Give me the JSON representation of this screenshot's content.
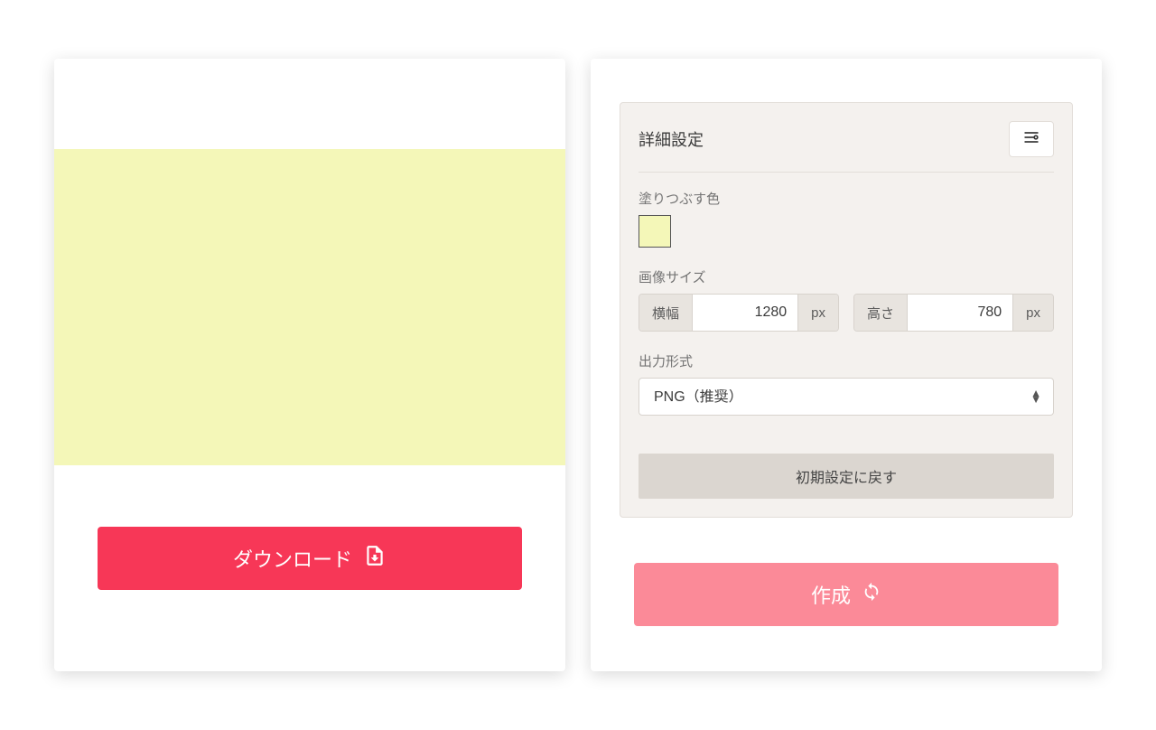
{
  "preview": {
    "fill_color": "#F4F7B8"
  },
  "settings": {
    "title": "詳細設定",
    "fill_color": {
      "label": "塗りつぶす色",
      "value": "#F4F7B8"
    },
    "image_size": {
      "label": "画像サイズ",
      "width_label": "横幅",
      "width_value": "1280",
      "height_label": "高さ",
      "height_value": "780",
      "unit": "px"
    },
    "output_format": {
      "label": "出力形式",
      "selected": "PNG（推奨）"
    },
    "reset_label": "初期設定に戻す"
  },
  "buttons": {
    "download": "ダウンロード",
    "create": "作成"
  },
  "colors": {
    "download_btn": "#F73757",
    "create_btn": "#FB8A98"
  }
}
